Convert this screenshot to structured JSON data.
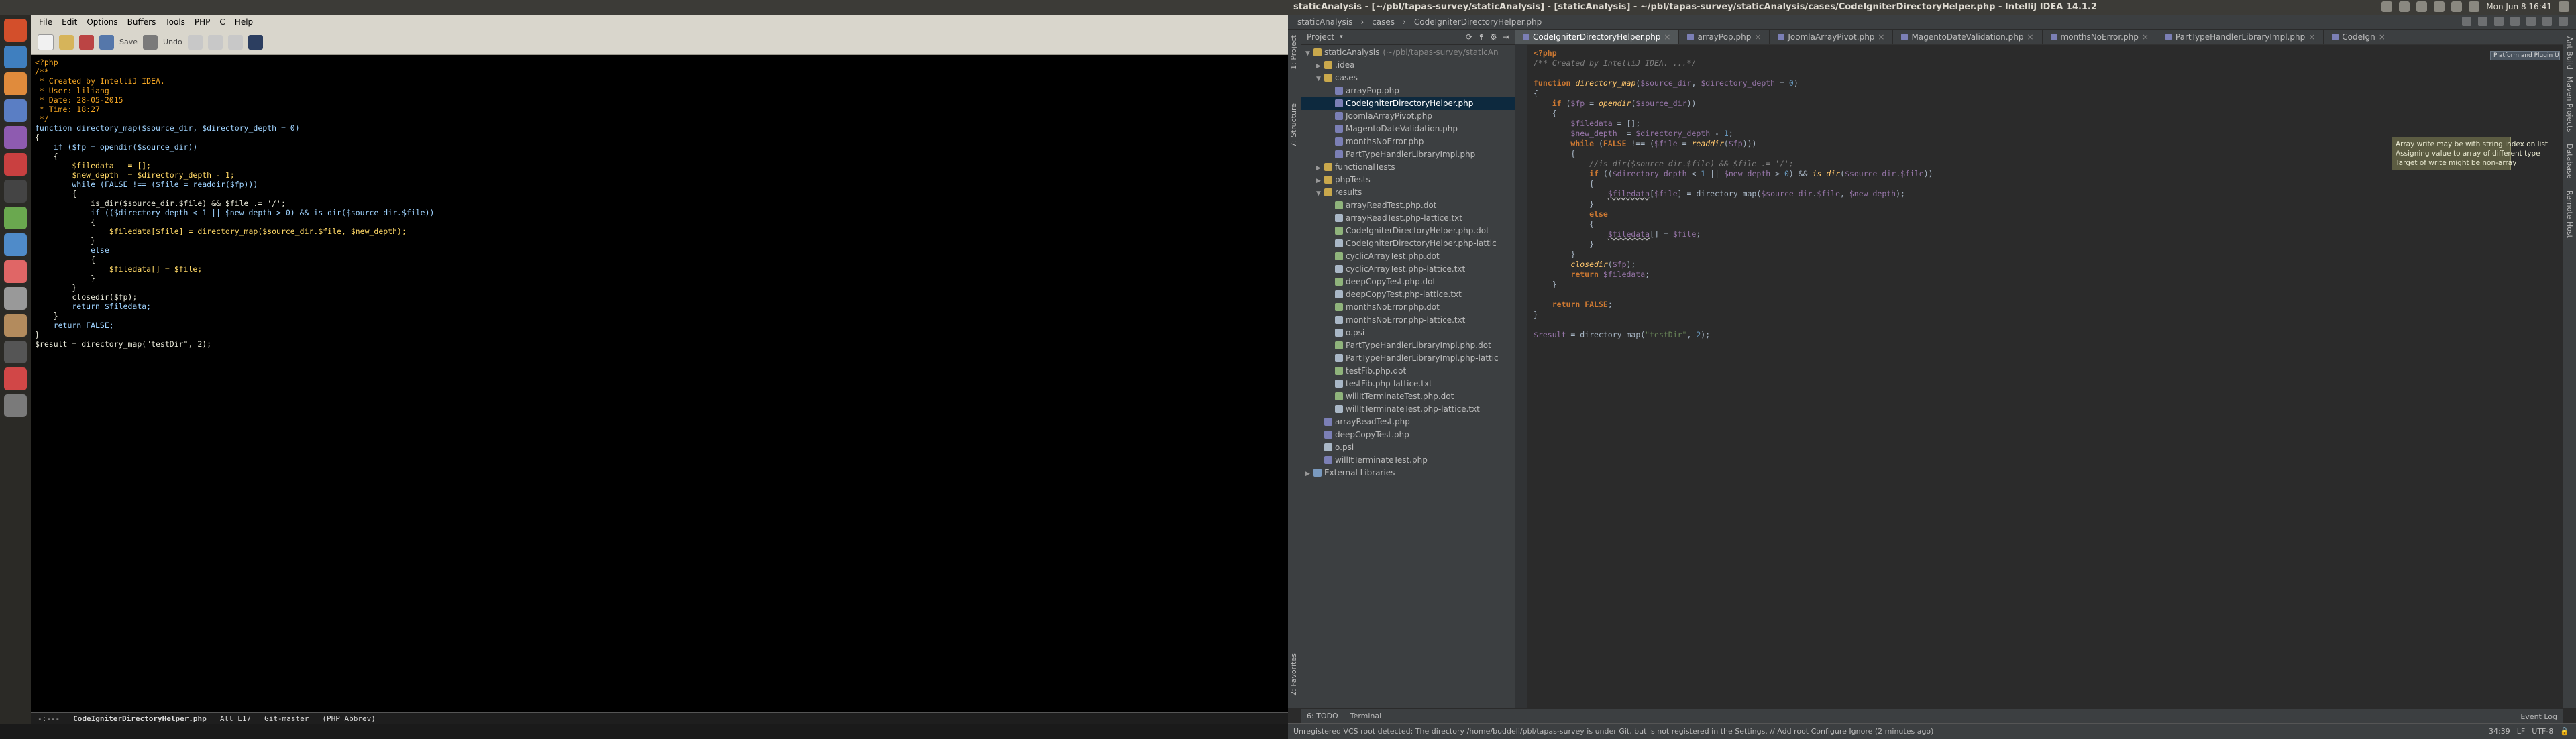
{
  "system": {
    "window_title": "staticAnalysis - [~/pbl/tapas-survey/staticAnalysis] - [staticAnalysis] - ~/pbl/tapas-survey/staticAnalysis/cases/CodeIgniterDirectoryHelper.php - IntelliJ IDEA 14.1.2",
    "clock_left": "Mon Jun 8 16:41",
    "clock_right": "Mon Jun 8 16:41"
  },
  "emacs": {
    "menu": [
      "File",
      "Edit",
      "Options",
      "Buffers",
      "Tools",
      "PHP",
      "C",
      "Help"
    ],
    "toolbar": {
      "save_label": "Save",
      "undo_label": "Undo"
    },
    "code_lines": [
      "<?php",
      "/**",
      " * Created by IntelliJ IDEA.",
      " * User: liliang",
      " * Date: 28-05-2015",
      " * Time: 18:27",
      " */",
      "",
      "function directory_map($source_dir, $directory_depth = 0)",
      "{",
      "    if ($fp = opendir($source_dir))",
      "    {",
      "        $filedata   = [];",
      "        $new_depth  = $directory_depth - 1;",
      "        while (FALSE !== ($file = readdir($fp)))",
      "        {",
      "            is_dir($source_dir.$file) && $file .= '/';",
      "",
      "            if (($directory_depth < 1 || $new_depth > 0) && is_dir($source_dir.$file))",
      "            {",
      "                $filedata[$file] = directory_map($source_dir.$file, $new_depth);",
      "            }",
      "            else",
      "            {",
      "                $filedata[] = $file;",
      "            }",
      "        }",
      "        closedir($fp);",
      "        return $filedata;",
      "    }",
      "",
      "    return FALSE;",
      "}",
      "$result = directory_map(\"testDir\", 2);"
    ],
    "modeline": {
      "status": "-:---",
      "buffer": "CodeIgniterDirectoryHelper.php",
      "position": "All L17",
      "vcs": "Git-master",
      "mode": "(PHP Abbrev)"
    }
  },
  "idea": {
    "breadcrumbs": [
      "staticAnalysis",
      "cases",
      "CodeIgniterDirectoryHelper.php"
    ],
    "project_header": "Project",
    "tree": [
      {
        "label": "staticAnalysis",
        "note": "(~/pbl/tapas-survey/staticAn",
        "type": "folder",
        "depth": 0,
        "open": true
      },
      {
        "label": ".idea",
        "type": "folder",
        "depth": 1,
        "open": false
      },
      {
        "label": "cases",
        "type": "folder",
        "depth": 1,
        "open": true
      },
      {
        "label": "arrayPop.php",
        "type": "php",
        "depth": 2
      },
      {
        "label": "CodeIgniterDirectoryHelper.php",
        "type": "php",
        "depth": 2,
        "selected": true
      },
      {
        "label": "JoomlaArrayPivot.php",
        "type": "php",
        "depth": 2
      },
      {
        "label": "MagentoDateValidation.php",
        "type": "php",
        "depth": 2
      },
      {
        "label": "monthsNoError.php",
        "type": "php",
        "depth": 2
      },
      {
        "label": "PartTypeHandlerLibraryImpl.php",
        "type": "php",
        "depth": 2
      },
      {
        "label": "functionalTests",
        "type": "folder",
        "depth": 1,
        "open": false
      },
      {
        "label": "phpTests",
        "type": "folder",
        "depth": 1,
        "open": false
      },
      {
        "label": "results",
        "type": "folder",
        "depth": 1,
        "open": true
      },
      {
        "label": "arrayReadTest.php.dot",
        "type": "dot",
        "depth": 2
      },
      {
        "label": "arrayReadTest.php-lattice.txt",
        "type": "txt",
        "depth": 2
      },
      {
        "label": "CodeIgniterDirectoryHelper.php.dot",
        "type": "dot",
        "depth": 2
      },
      {
        "label": "CodeIgniterDirectoryHelper.php-lattic",
        "type": "txt",
        "depth": 2
      },
      {
        "label": "cyclicArrayTest.php.dot",
        "type": "dot",
        "depth": 2
      },
      {
        "label": "cyclicArrayTest.php-lattice.txt",
        "type": "txt",
        "depth": 2
      },
      {
        "label": "deepCopyTest.php.dot",
        "type": "dot",
        "depth": 2
      },
      {
        "label": "deepCopyTest.php-lattice.txt",
        "type": "txt",
        "depth": 2
      },
      {
        "label": "monthsNoError.php.dot",
        "type": "dot",
        "depth": 2
      },
      {
        "label": "monthsNoError.php-lattice.txt",
        "type": "txt",
        "depth": 2
      },
      {
        "label": "o.psi",
        "type": "txt",
        "depth": 2
      },
      {
        "label": "PartTypeHandlerLibraryImpl.php.dot",
        "type": "dot",
        "depth": 2
      },
      {
        "label": "PartTypeHandlerLibraryImpl.php-lattic",
        "type": "txt",
        "depth": 2
      },
      {
        "label": "testFib.php.dot",
        "type": "dot",
        "depth": 2
      },
      {
        "label": "testFib.php-lattice.txt",
        "type": "txt",
        "depth": 2
      },
      {
        "label": "willItTerminateTest.php.dot",
        "type": "dot",
        "depth": 2
      },
      {
        "label": "willItTerminateTest.php-lattice.txt",
        "type": "txt",
        "depth": 2
      },
      {
        "label": "arrayReadTest.php",
        "type": "php",
        "depth": 1
      },
      {
        "label": "deepCopyTest.php",
        "type": "php",
        "depth": 1
      },
      {
        "label": "o.psi",
        "type": "txt",
        "depth": 1
      },
      {
        "label": "willItTerminateTest.php",
        "type": "php",
        "depth": 1
      },
      {
        "label": "External Libraries",
        "type": "lib",
        "depth": 0,
        "open": false
      }
    ],
    "tabs": [
      {
        "label": "CodeIgniterDirectoryHelper.php",
        "active": true
      },
      {
        "label": "arrayPop.php",
        "active": false
      },
      {
        "label": "JoomlaArrayPivot.php",
        "active": false
      },
      {
        "label": "MagentoDateValidation.php",
        "active": false
      },
      {
        "label": "monthsNoError.php",
        "active": false
      },
      {
        "label": "PartTypeHandlerLibraryImpl.php",
        "active": false
      },
      {
        "label": "CodeIgn",
        "active": false
      }
    ],
    "notification": "Platform and Plugin Updates",
    "tooltip": [
      "Array write may be with string index on list",
      "Assigning value to array of different type",
      "Target of write might be non-array"
    ],
    "left_tool_tabs": [
      "1: Project",
      "7: Structure",
      "2: Favorites"
    ],
    "right_tool_tabs": [
      "Ant Build",
      "Maven Projects",
      "Database",
      "Remote Host"
    ],
    "bottom_tabs": {
      "todo": "6: TODO",
      "terminal": "Terminal",
      "event_log": "Event Log"
    },
    "status": {
      "message": "Unregistered VCS root detected: The directory /home/buddeli/pbl/tapas-survey is under Git, but is not registered in the Settings. // Add root  Configure  Ignore (2 minutes ago)",
      "position": "34:39",
      "line_sep": "LF",
      "encoding": "UTF-8"
    }
  }
}
